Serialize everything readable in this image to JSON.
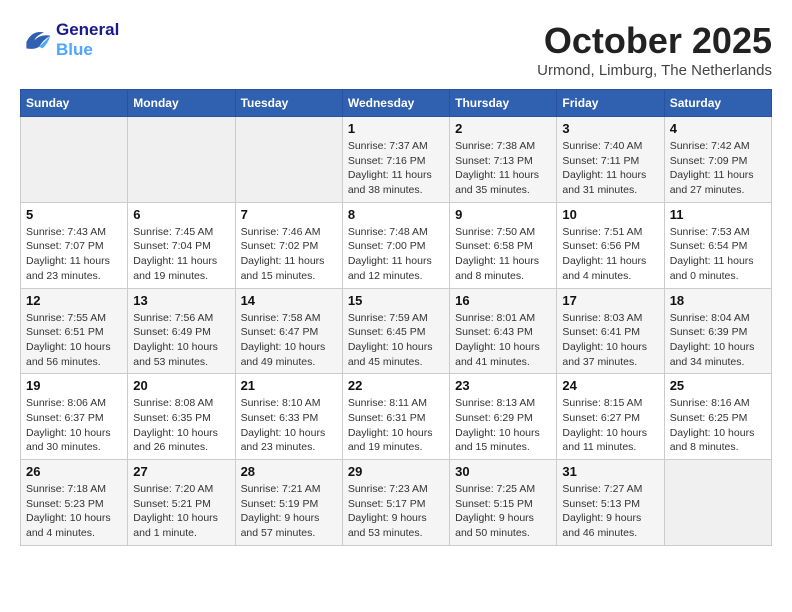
{
  "header": {
    "logo_line1": "General",
    "logo_line2": "Blue",
    "month_title": "October 2025",
    "location": "Urmond, Limburg, The Netherlands"
  },
  "weekdays": [
    "Sunday",
    "Monday",
    "Tuesday",
    "Wednesday",
    "Thursday",
    "Friday",
    "Saturday"
  ],
  "weeks": [
    [
      {
        "day": "",
        "info": ""
      },
      {
        "day": "",
        "info": ""
      },
      {
        "day": "",
        "info": ""
      },
      {
        "day": "1",
        "info": "Sunrise: 7:37 AM\nSunset: 7:16 PM\nDaylight: 11 hours and 38 minutes."
      },
      {
        "day": "2",
        "info": "Sunrise: 7:38 AM\nSunset: 7:13 PM\nDaylight: 11 hours and 35 minutes."
      },
      {
        "day": "3",
        "info": "Sunrise: 7:40 AM\nSunset: 7:11 PM\nDaylight: 11 hours and 31 minutes."
      },
      {
        "day": "4",
        "info": "Sunrise: 7:42 AM\nSunset: 7:09 PM\nDaylight: 11 hours and 27 minutes."
      }
    ],
    [
      {
        "day": "5",
        "info": "Sunrise: 7:43 AM\nSunset: 7:07 PM\nDaylight: 11 hours and 23 minutes."
      },
      {
        "day": "6",
        "info": "Sunrise: 7:45 AM\nSunset: 7:04 PM\nDaylight: 11 hours and 19 minutes."
      },
      {
        "day": "7",
        "info": "Sunrise: 7:46 AM\nSunset: 7:02 PM\nDaylight: 11 hours and 15 minutes."
      },
      {
        "day": "8",
        "info": "Sunrise: 7:48 AM\nSunset: 7:00 PM\nDaylight: 11 hours and 12 minutes."
      },
      {
        "day": "9",
        "info": "Sunrise: 7:50 AM\nSunset: 6:58 PM\nDaylight: 11 hours and 8 minutes."
      },
      {
        "day": "10",
        "info": "Sunrise: 7:51 AM\nSunset: 6:56 PM\nDaylight: 11 hours and 4 minutes."
      },
      {
        "day": "11",
        "info": "Sunrise: 7:53 AM\nSunset: 6:54 PM\nDaylight: 11 hours and 0 minutes."
      }
    ],
    [
      {
        "day": "12",
        "info": "Sunrise: 7:55 AM\nSunset: 6:51 PM\nDaylight: 10 hours and 56 minutes."
      },
      {
        "day": "13",
        "info": "Sunrise: 7:56 AM\nSunset: 6:49 PM\nDaylight: 10 hours and 53 minutes."
      },
      {
        "day": "14",
        "info": "Sunrise: 7:58 AM\nSunset: 6:47 PM\nDaylight: 10 hours and 49 minutes."
      },
      {
        "day": "15",
        "info": "Sunrise: 7:59 AM\nSunset: 6:45 PM\nDaylight: 10 hours and 45 minutes."
      },
      {
        "day": "16",
        "info": "Sunrise: 8:01 AM\nSunset: 6:43 PM\nDaylight: 10 hours and 41 minutes."
      },
      {
        "day": "17",
        "info": "Sunrise: 8:03 AM\nSunset: 6:41 PM\nDaylight: 10 hours and 37 minutes."
      },
      {
        "day": "18",
        "info": "Sunrise: 8:04 AM\nSunset: 6:39 PM\nDaylight: 10 hours and 34 minutes."
      }
    ],
    [
      {
        "day": "19",
        "info": "Sunrise: 8:06 AM\nSunset: 6:37 PM\nDaylight: 10 hours and 30 minutes."
      },
      {
        "day": "20",
        "info": "Sunrise: 8:08 AM\nSunset: 6:35 PM\nDaylight: 10 hours and 26 minutes."
      },
      {
        "day": "21",
        "info": "Sunrise: 8:10 AM\nSunset: 6:33 PM\nDaylight: 10 hours and 23 minutes."
      },
      {
        "day": "22",
        "info": "Sunrise: 8:11 AM\nSunset: 6:31 PM\nDaylight: 10 hours and 19 minutes."
      },
      {
        "day": "23",
        "info": "Sunrise: 8:13 AM\nSunset: 6:29 PM\nDaylight: 10 hours and 15 minutes."
      },
      {
        "day": "24",
        "info": "Sunrise: 8:15 AM\nSunset: 6:27 PM\nDaylight: 10 hours and 11 minutes."
      },
      {
        "day": "25",
        "info": "Sunrise: 8:16 AM\nSunset: 6:25 PM\nDaylight: 10 hours and 8 minutes."
      }
    ],
    [
      {
        "day": "26",
        "info": "Sunrise: 7:18 AM\nSunset: 5:23 PM\nDaylight: 10 hours and 4 minutes."
      },
      {
        "day": "27",
        "info": "Sunrise: 7:20 AM\nSunset: 5:21 PM\nDaylight: 10 hours and 1 minute."
      },
      {
        "day": "28",
        "info": "Sunrise: 7:21 AM\nSunset: 5:19 PM\nDaylight: 9 hours and 57 minutes."
      },
      {
        "day": "29",
        "info": "Sunrise: 7:23 AM\nSunset: 5:17 PM\nDaylight: 9 hours and 53 minutes."
      },
      {
        "day": "30",
        "info": "Sunrise: 7:25 AM\nSunset: 5:15 PM\nDaylight: 9 hours and 50 minutes."
      },
      {
        "day": "31",
        "info": "Sunrise: 7:27 AM\nSunset: 5:13 PM\nDaylight: 9 hours and 46 minutes."
      },
      {
        "day": "",
        "info": ""
      }
    ]
  ]
}
